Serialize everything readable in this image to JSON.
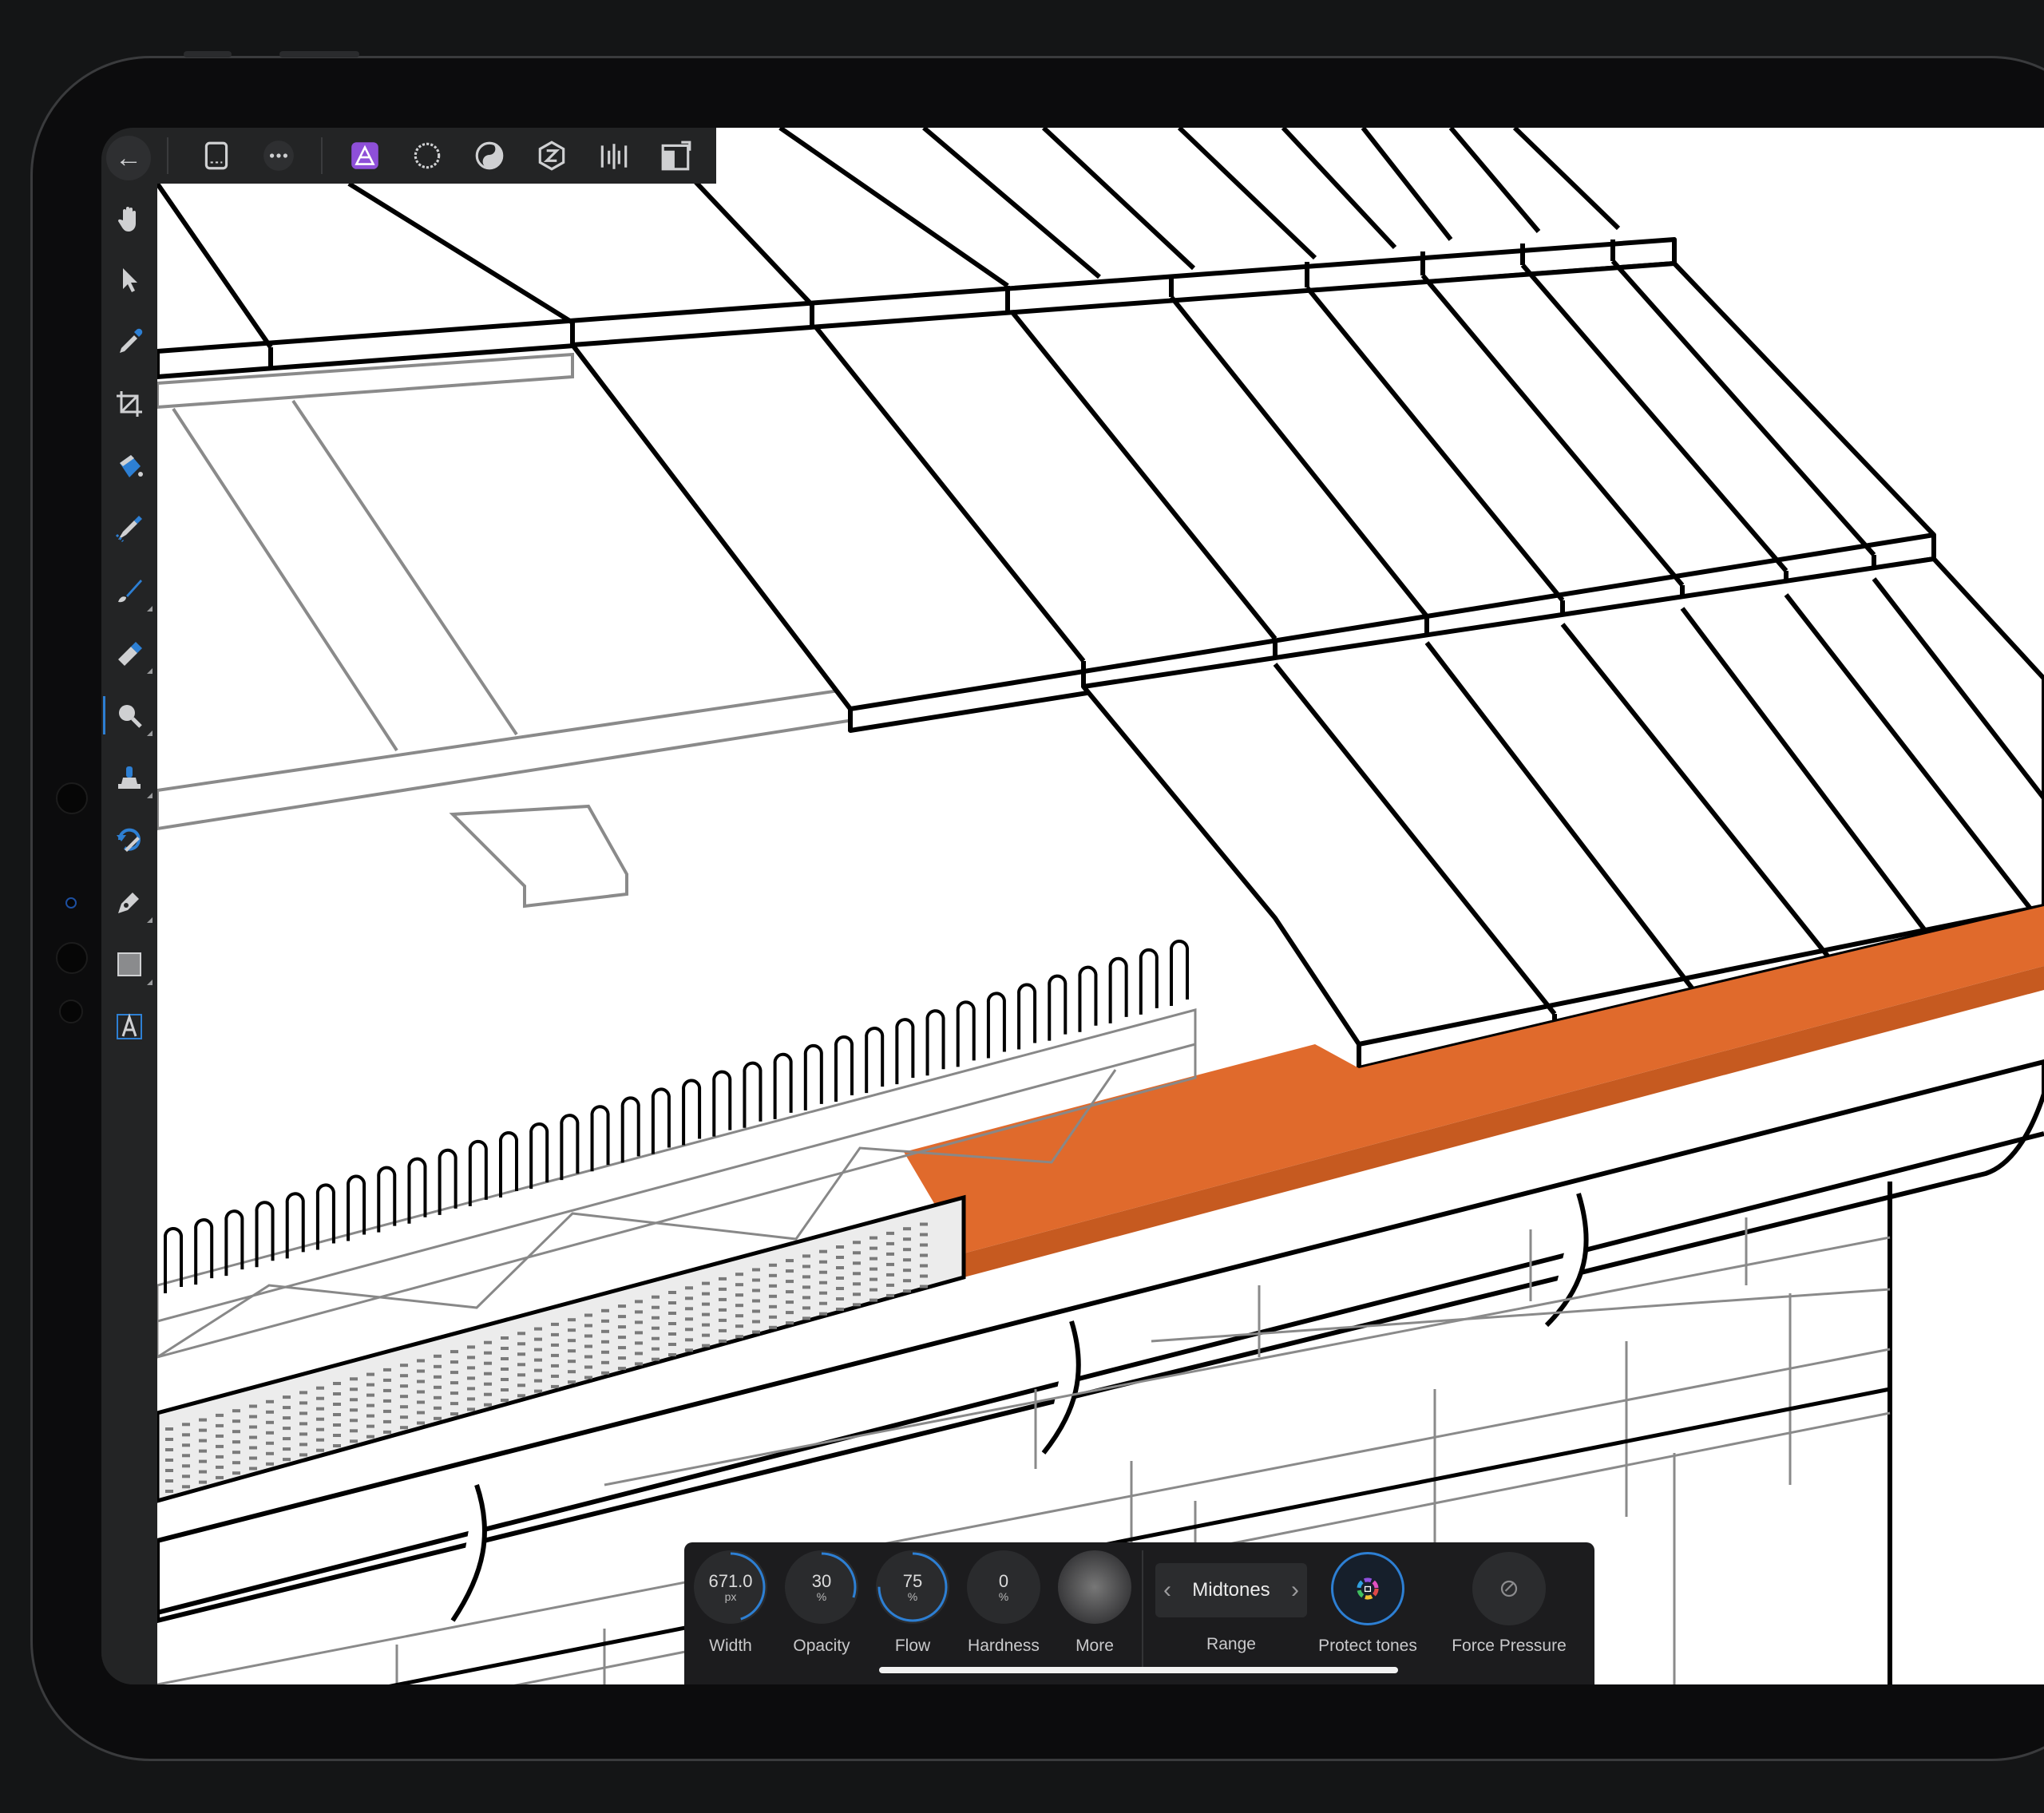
{
  "toolbar_top": {
    "icons": [
      "document-icon",
      "more-icon",
      "photo-persona-icon",
      "liquify-persona-icon",
      "develop-persona-icon",
      "tone-mapping-persona-icon",
      "export-persona-icon",
      "split-view-icon"
    ]
  },
  "tools": [
    "hand-tool-icon",
    "move-tool-icon",
    "color-picker-icon",
    "crop-tool-icon",
    "flood-fill-icon",
    "selection-brush-icon",
    "paint-brush-icon",
    "erase-brush-icon",
    "dodge-brush-icon",
    "clone-brush-icon",
    "undo-brush-icon",
    "pen-tool-icon",
    "rectangle-tool-icon",
    "text-tool-icon"
  ],
  "context_toolbar": {
    "width": {
      "value": "671.0",
      "unit": "px",
      "label": "Width"
    },
    "opacity": {
      "value": "30",
      "unit": "%",
      "label": "Opacity",
      "level": 0.3
    },
    "flow": {
      "value": "75",
      "unit": "%",
      "label": "Flow",
      "level": 0.75
    },
    "hardness": {
      "value": "0",
      "unit": "%",
      "label": "Hardness",
      "level": 0
    },
    "more": {
      "label": "More"
    },
    "range": {
      "value": "Midtones",
      "label": "Range"
    },
    "protect_tones": {
      "label": "Protect tones"
    },
    "force_pressure": {
      "label": "Force Pressure"
    }
  },
  "colors": {
    "accent": "#2d7fd3",
    "flashing": "#e06a2c",
    "persona": "#8e4fd8"
  }
}
